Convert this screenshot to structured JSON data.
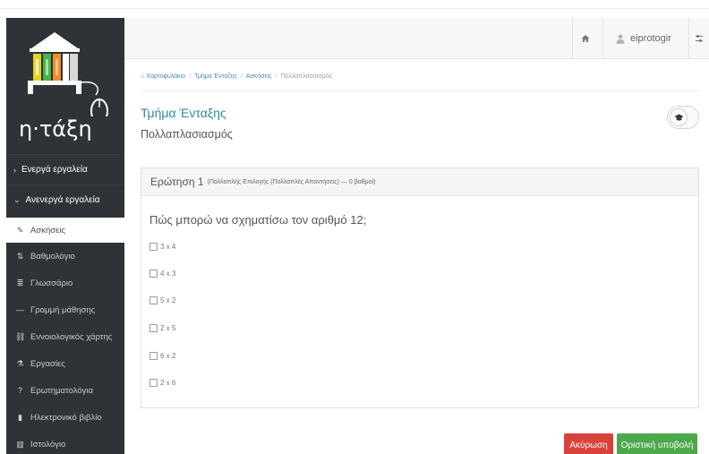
{
  "app": {
    "logo_text": "η·τάξη"
  },
  "header": {
    "home_icon": "home-icon",
    "username": "eiprotogir",
    "user_icon": "user-icon",
    "settings_icon": "sliders-icon"
  },
  "sidebar": {
    "sections": [
      {
        "label": "Ενεργά εργαλεία",
        "chevron": "›"
      },
      {
        "label": "Ανενεργά εργαλεία",
        "chevron": "⌄"
      }
    ],
    "items": [
      {
        "label": "Ασκήσεις",
        "icon": "edit-icon",
        "glyph": "✎",
        "active": true
      },
      {
        "label": "Βαθμολόγιο",
        "icon": "sort-numeric-icon",
        "glyph": "⇅",
        "active": false
      },
      {
        "label": "Γλωσσάριο",
        "icon": "list-icon",
        "glyph": "≣",
        "active": false
      },
      {
        "label": "Γραμμή μάθησης",
        "icon": "minus-icon",
        "glyph": "—",
        "active": false
      },
      {
        "label": "Εννοιολογικός χάρτης",
        "icon": "sitemap-icon",
        "glyph": "⛓",
        "active": false
      },
      {
        "label": "Εργασίες",
        "icon": "flask-icon",
        "glyph": "⚗",
        "active": false
      },
      {
        "label": "Ερωτηματολόγια",
        "icon": "question-circle-icon",
        "glyph": "?",
        "active": false
      },
      {
        "label": "Ηλεκτρονικό βιβλίο",
        "icon": "book-icon",
        "glyph": "▮",
        "active": false
      },
      {
        "label": "Ιστολόγιο",
        "icon": "columns-icon",
        "glyph": "▥",
        "active": false
      }
    ]
  },
  "breadcrumb": {
    "items": [
      "Χαρτοφυλάκιο",
      "Τμήμα Ένταξης",
      "Ασκήσεις",
      "Πολλαπλασιασμός"
    ],
    "separator": "/"
  },
  "page": {
    "title": "Τμήμα Ένταξης",
    "subtitle": "Πολλαπλασιασμός"
  },
  "question": {
    "title": "Ερώτηση 1",
    "meta": "(Πολλαπλής Επιλογής (Πολλαπλές Απαντήσεις) — 0 βαθμοί)",
    "text": "Πώς μπορώ να σχηματίσω τον αριθμό 12;",
    "options": [
      "3 x 4",
      "4 x 3",
      "5 x 2",
      "2 x 5",
      "6 x 2",
      "2 x 6"
    ]
  },
  "buttons": {
    "cancel": "Ακύρωση",
    "submit": "Οριστική υποβολή"
  },
  "colors": {
    "sidebar_bg": "#2f3338",
    "title_accent": "#2c8aa6",
    "cancel": "#d9423b",
    "submit": "#4ca84a"
  }
}
